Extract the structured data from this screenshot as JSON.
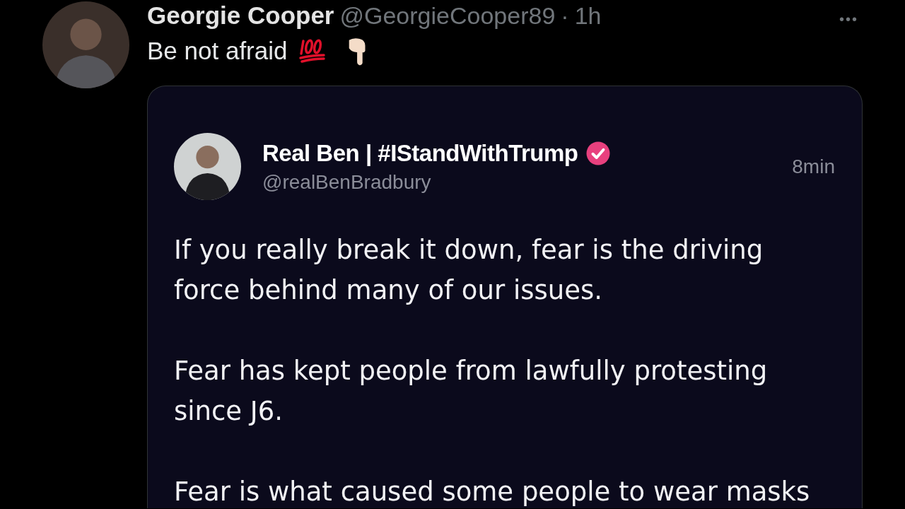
{
  "post": {
    "author": "Georgie Cooper",
    "handle": "@GeorgieCooper89",
    "separator": "·",
    "time": "1h",
    "more": "•••",
    "text": "Be not afraid"
  },
  "quote": {
    "author": "Real Ben | #IStandWithTrump",
    "verified": true,
    "handle": "@realBenBradbury",
    "time": "8min",
    "paragraphs": [
      "If you really break it down, fear is the driving force behind many of our issues.",
      "Fear has kept people from lawfully protesting since J6.",
      "Fear is what caused some people to wear masks"
    ]
  }
}
